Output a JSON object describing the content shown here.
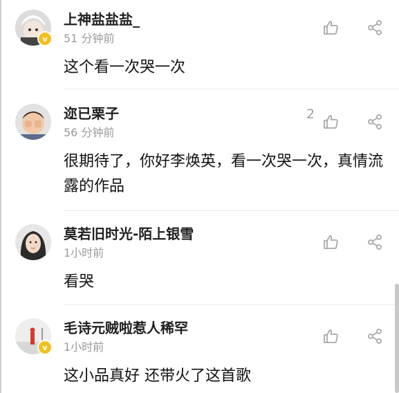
{
  "comments": [
    {
      "name": "上神盐盐盐_",
      "time": "51 分钟前",
      "text": "这个看一次哭一次",
      "likes": "",
      "verified": "v"
    },
    {
      "name": "迩已栗子",
      "time": "56 分钟前",
      "text": "很期待了，你好李焕英，看一次哭一次，真情流露的作品",
      "likes": "2",
      "verified": ""
    },
    {
      "name": "莫若旧时光-陌上银雪",
      "time": "1小时前",
      "text": "看哭",
      "likes": "",
      "verified": ""
    },
    {
      "name": "毛诗元贼啦惹人稀罕",
      "time": "1小时前",
      "text": "这小品真好 还带火了这首歌",
      "likes": "",
      "verified": "v"
    }
  ],
  "colors": {
    "name": "#1f1f1f",
    "time": "#9a9a9a",
    "icon": "#a8a8a8",
    "badge": "#f3bf1f"
  },
  "icons": {
    "like": "thumbs-up-icon",
    "share": "share-icon"
  }
}
